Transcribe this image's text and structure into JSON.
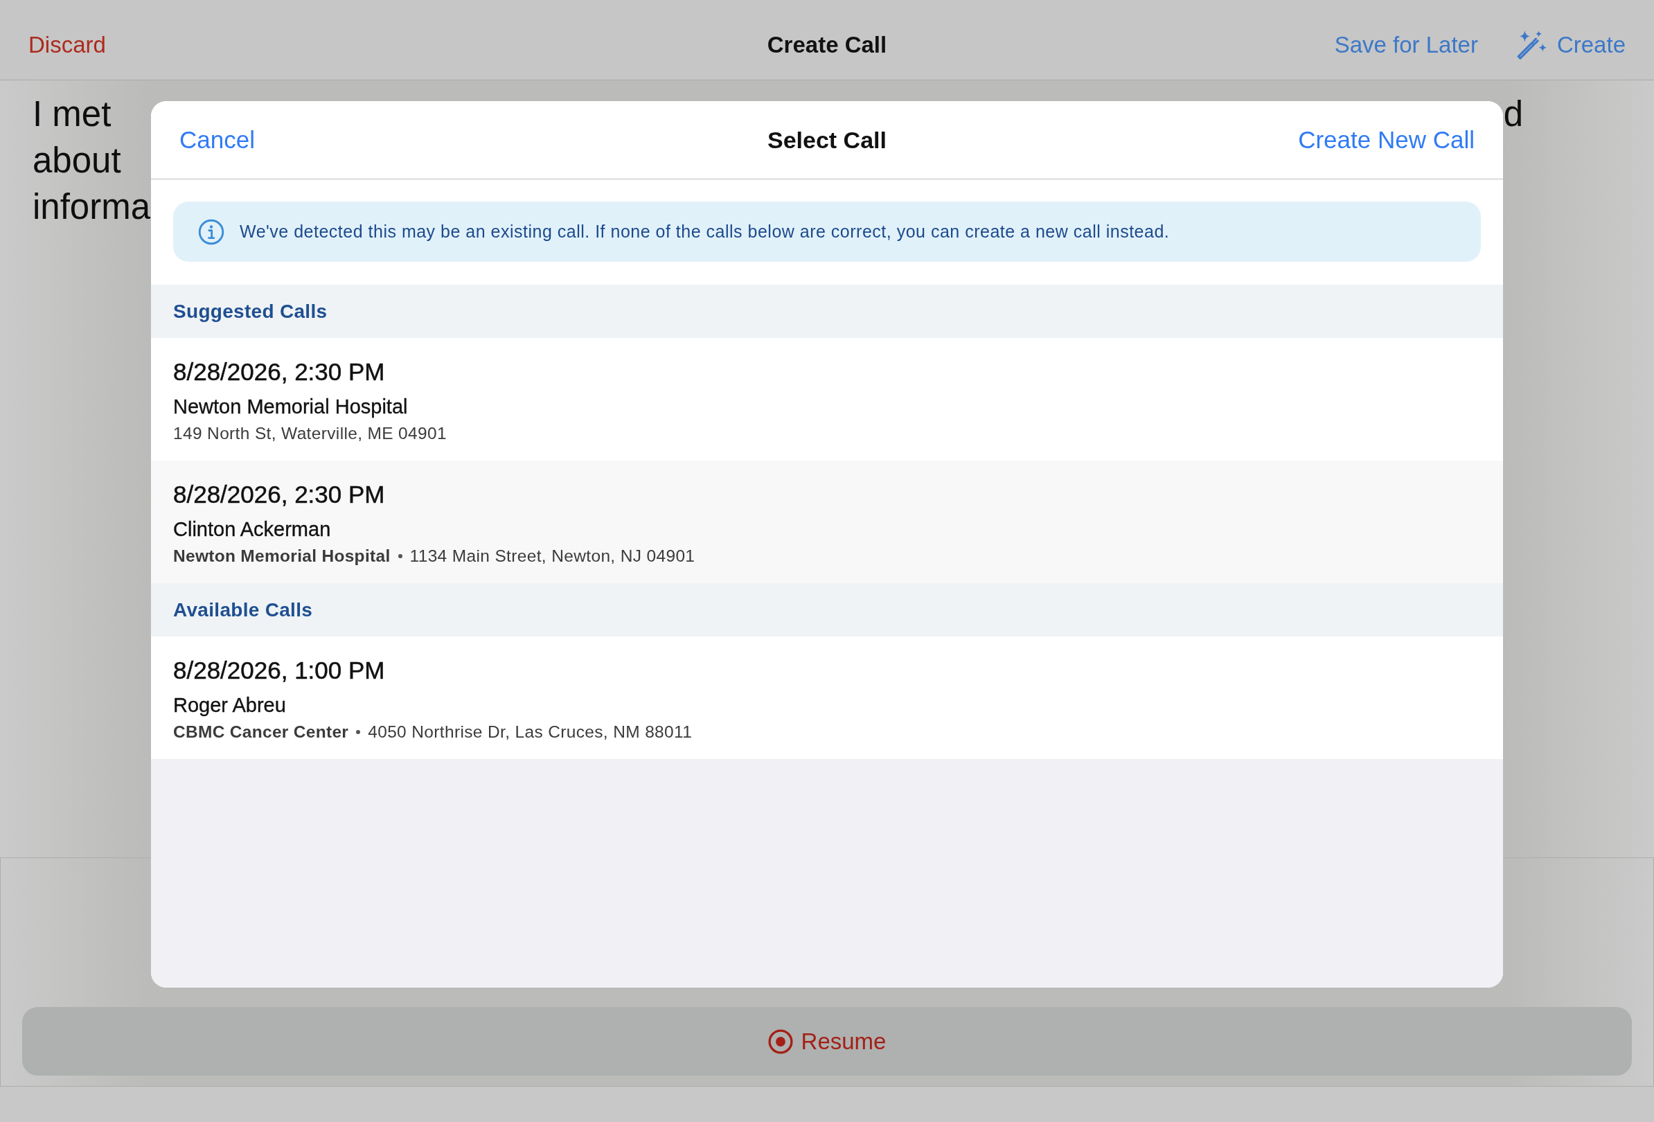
{
  "nav_bar": {
    "discard": "Discard",
    "title": "Create Call",
    "save_for_later": "Save for Later",
    "create": "Create"
  },
  "note": {
    "lines": [
      {
        "start": "I met",
        "end": "d"
      },
      {
        "start": "about"
      },
      {
        "start": "informa"
      }
    ]
  },
  "modal": {
    "cancel": "Cancel",
    "title": "Select Call",
    "create_new": "Create New Call",
    "banner": "We've detected this may be an existing call. If none of the calls below are correct, you can create a new call instead.",
    "sections": [
      {
        "title": "Suggested Calls",
        "calls": [
          {
            "datetime": "8/28/2026, 2:30 PM",
            "name": "Newton Memorial Hospital",
            "address": "149 North St, Waterville, ME 04901"
          },
          {
            "datetime": "8/28/2026, 2:30 PM",
            "name": "Clinton Ackerman",
            "organization": "Newton Memorial Hospital",
            "address": "1134 Main Street, Newton, NJ 04901"
          }
        ]
      },
      {
        "title": "Available Calls",
        "calls": [
          {
            "datetime": "8/28/2026, 1:00 PM",
            "name": "Roger Abreu",
            "organization": "CBMC Cancer Center",
            "address": "4050 Northrise Dr, Las Cruces, NM 88011"
          }
        ]
      }
    ]
  },
  "resume": "Resume"
}
